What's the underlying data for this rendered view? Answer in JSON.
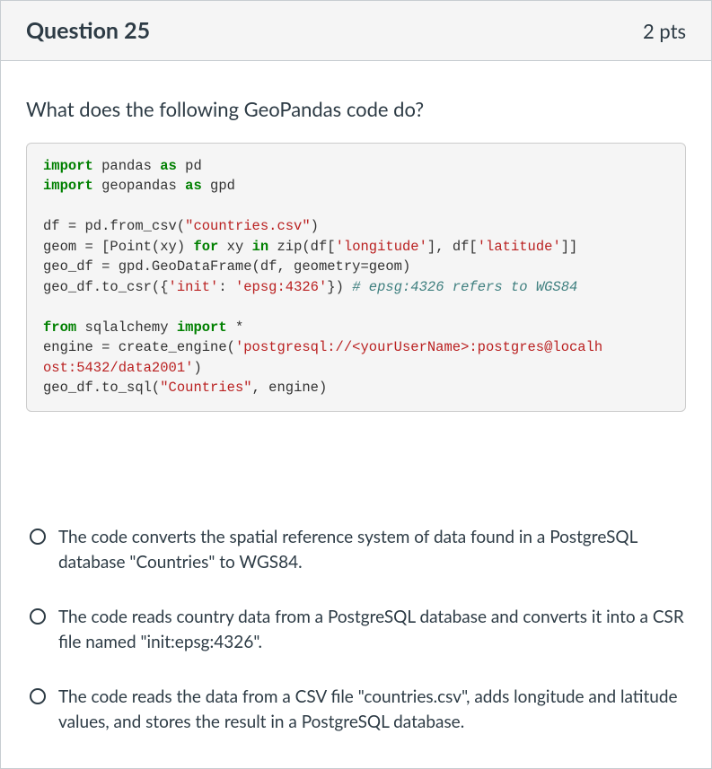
{
  "header": {
    "title": "Question 25",
    "points": "2 pts"
  },
  "body": {
    "prompt": "What does the following GeoPandas code do?"
  },
  "code": {
    "kw_import1": "import",
    "txt_pandas": " pandas ",
    "kw_as1": "as",
    "txt_pd": " pd",
    "kw_import2": "import",
    "txt_geopandas": " geopandas ",
    "kw_as2": "as",
    "txt_gpd": " gpd",
    "blank1": "",
    "df_assign": "df = pd.from_csv(",
    "str_countries_csv": "\"countries.csv\"",
    "close1": ")",
    "geom_assign1": "geom = [Point(xy) ",
    "kw_for": "for",
    "geom_assign2": " xy ",
    "kw_in": "in",
    "geom_assign3": " zip(df[",
    "str_longitude": "'longitude'",
    "geom_assign4": "], df[",
    "str_latitude": "'latitude'",
    "geom_assign5": "]]",
    "geodf_assign": "geo_df = gpd.GeoDataFrame(df, geometry=geom)",
    "tocrs1": "geo_df.to_csr({",
    "str_init": "'init'",
    "tocrs2": ": ",
    "str_epsg": "'epsg:4326'",
    "tocrs3": "}) ",
    "cmt_epsg": "# epsg:4326 refers to WGS84",
    "blank2": "",
    "kw_from": "from",
    "txt_sqlalchemy": " sqlalchemy ",
    "kw_import3": "import",
    "txt_star": " *",
    "engine1": "engine = create_engine(",
    "str_conn": "'postgresql://<yourUserName>:postgres@localh\nost:5432/data2001'",
    "engine2": ")",
    "tosql1": "geo_df.to_sql(",
    "str_Countries": "\"Countries\"",
    "tosql2": ", engine)"
  },
  "options": [
    "The code converts the spatial reference system of data found in a PostgreSQL database \"Countries\" to WGS84.",
    "The code reads country data from a PostgreSQL database and converts it into a CSR file named \"init:epsg:4326\".",
    "The code reads the data from a CSV file \"countries.csv\", adds longitude and latitude values, and stores the result in a PostgreSQL database."
  ]
}
